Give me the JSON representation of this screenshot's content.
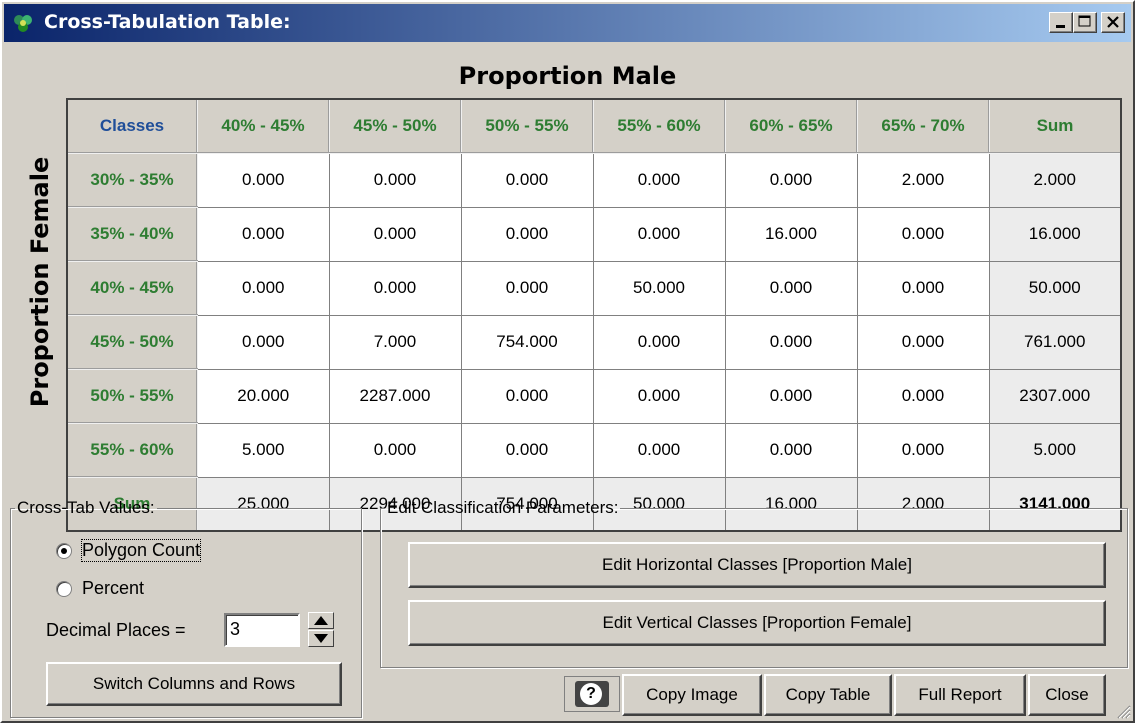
{
  "window": {
    "title": "Cross-Tabulation Table:"
  },
  "table": {
    "col_heading": "Proportion Male",
    "row_heading": "Proportion Female",
    "corner": "Classes",
    "columns": [
      "40% - 45%",
      "45% - 50%",
      "50% - 55%",
      "55% - 60%",
      "60% - 65%",
      "65% - 70%",
      "Sum"
    ],
    "rows": [
      {
        "label": "30% - 35%",
        "cells": [
          "0.000",
          "0.000",
          "0.000",
          "0.000",
          "0.000",
          "2.000",
          "2.000"
        ]
      },
      {
        "label": "35% - 40%",
        "cells": [
          "0.000",
          "0.000",
          "0.000",
          "0.000",
          "16.000",
          "0.000",
          "16.000"
        ]
      },
      {
        "label": "40% - 45%",
        "cells": [
          "0.000",
          "0.000",
          "0.000",
          "50.000",
          "0.000",
          "0.000",
          "50.000"
        ]
      },
      {
        "label": "45% - 50%",
        "cells": [
          "0.000",
          "7.000",
          "754.000",
          "0.000",
          "0.000",
          "0.000",
          "761.000"
        ]
      },
      {
        "label": "50% - 55%",
        "cells": [
          "20.000",
          "2287.000",
          "0.000",
          "0.000",
          "0.000",
          "0.000",
          "2307.000"
        ]
      },
      {
        "label": "55% - 60%",
        "cells": [
          "5.000",
          "0.000",
          "0.000",
          "0.000",
          "0.000",
          "0.000",
          "5.000"
        ]
      },
      {
        "label": "Sum",
        "cells": [
          "25.000",
          "2294.000",
          "754.000",
          "50.000",
          "16.000",
          "2.000",
          "3141.000"
        ]
      }
    ]
  },
  "crosstab": {
    "legend": "Cross-Tab Values:",
    "options": [
      "Polygon Count",
      "Percent"
    ],
    "selected": "Polygon Count",
    "decimal_label": "Decimal Places =",
    "decimal_value": "3",
    "switch_label": "Switch Columns and Rows"
  },
  "classification": {
    "legend": "Edit Classification Parameters:",
    "edit_horizontal": "Edit Horizontal Classes [Proportion Male]",
    "edit_vertical": "Edit Vertical Classes [Proportion Female]"
  },
  "bottom": {
    "help": "?",
    "copy_image": "Copy Image",
    "copy_table": "Copy Table",
    "full_report": "Full Report",
    "close": "Close"
  },
  "icons": {
    "app": "recycle-icon",
    "minimize": "minimize-icon",
    "maximize": "maximize-icon",
    "close": "close-icon",
    "spin_up": "arrow-up-icon",
    "spin_down": "arrow-down-icon",
    "help": "help-icon",
    "grip": "resize-grip-icon"
  },
  "colors": {
    "title_gradient_start": "#0a246a",
    "title_gradient_end": "#a6caf0",
    "header_text": "#2e7d32",
    "corner_text": "#1f4e99",
    "face": "#d4d0c8"
  }
}
